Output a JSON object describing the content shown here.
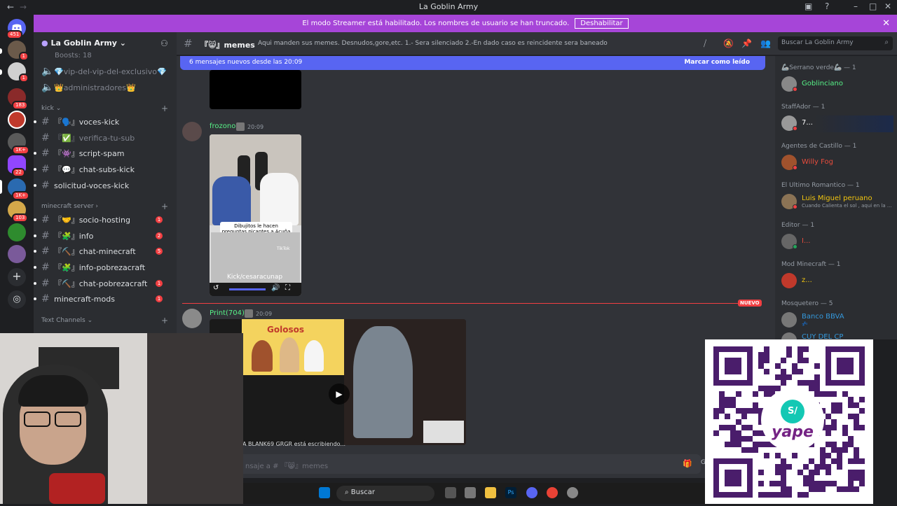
{
  "window": {
    "title": "La Goblin Army"
  },
  "banner": {
    "message": "El modo Streamer está habilitado. Los nombres de usuario se han truncado.",
    "button": "Deshabilitar",
    "color": "#a645d8"
  },
  "rail": {
    "badges": [
      "451",
      "1",
      "1",
      "183",
      "1K+",
      "22",
      "1K+",
      "103"
    ]
  },
  "sidebar": {
    "server_name": "La Goblin Army",
    "boosts": "Boosts: 18",
    "top_channels": [
      {
        "label": "💎vip-del-vip-del-exclusivo💎"
      },
      {
        "label": "👑administradores👑"
      }
    ],
    "categories": [
      {
        "name": "kick",
        "channels": [
          {
            "label": "『🗣️』voces-kick",
            "badge": ""
          },
          {
            "label": "『✅』verifica-tu-sub",
            "badge": ""
          },
          {
            "label": "『👾』script-spam",
            "badge": ""
          },
          {
            "label": "『💬』chat-subs-kick",
            "badge": ""
          },
          {
            "label": "solicitud-voces-kick",
            "badge": ""
          }
        ]
      },
      {
        "name": "minecraft server",
        "channels": [
          {
            "label": "『🤝』socio-hosting",
            "badge": "1"
          },
          {
            "label": "『🧩』info",
            "badge": "2"
          },
          {
            "label": "『⛏️』chat-minecraft",
            "badge": "5"
          },
          {
            "label": "『🧩』info-pobrezacraft",
            "badge": ""
          },
          {
            "label": "『⛏️』chat-pobrezacraft",
            "badge": "1"
          },
          {
            "label": "minecraft-mods",
            "badge": "1"
          }
        ]
      },
      {
        "name": "Text Channels",
        "channels": []
      }
    ]
  },
  "header": {
    "channel": "『😸』memes",
    "topic": "Aqui manden sus memes. Desnudos,gore,etc. 1.- Sera silenciado 2.-En dado caso es reincidente sera baneado",
    "search_placeholder": "Buscar La Goblin Army"
  },
  "chat": {
    "new_bar": {
      "text": "6 mensajes nuevos desde las 20:09",
      "action": "Marcar como leído"
    },
    "messages": [
      {
        "author": "frozono",
        "time": "20:09",
        "author_color": "#57f287",
        "caption": "Dibujitos le hacen preguntas picantes a Acuña 😳🥶",
        "video_label": "Kick/cesaracunap",
        "tiktok": "TikTok"
      },
      {
        "author": "Print(704)",
        "time": "20:09",
        "author_color": "#57f287",
        "video_title": "Golosos"
      }
    ],
    "new_label": "NUEVO",
    "typing": "A BLANK69 GRGR está escribiendo...",
    "composer_placeholder": "nsaje a # 『😸』memes"
  },
  "members": {
    "groups": [
      {
        "role": "🦾Serrano verde🦾 — 1",
        "members": [
          {
            "name": "Goblinciano",
            "color": "#57f287",
            "status": ""
          }
        ]
      },
      {
        "role": "StaffAdor — 1",
        "members": [
          {
            "name": "7...",
            "color": "#ffffff",
            "status": ""
          }
        ]
      },
      {
        "role": "Agentes de Castillo — 1",
        "members": [
          {
            "name": "Willy Fog",
            "color": "#e74c3c",
            "status": ""
          }
        ]
      },
      {
        "role": "El Ultimo Romantico — 1",
        "members": [
          {
            "name": "Luis Miguel peruano",
            "color": "#f1c40f",
            "status": "Cuando Calienta el sol , aqui en la ..."
          }
        ]
      },
      {
        "role": "Editor — 1",
        "members": [
          {
            "name": "I...",
            "color": "#e74c3c",
            "status": ""
          }
        ]
      },
      {
        "role": "Mod Minecraft — 1",
        "members": [
          {
            "name": "z...",
            "color": "#f1c40f",
            "status": ""
          }
        ]
      },
      {
        "role": "Mosquetero — 5",
        "members": [
          {
            "name": "Banco BBVA",
            "color": "#3498db",
            "status": "💤"
          },
          {
            "name": "CUY DEL CP",
            "color": "#3498db",
            "status": ""
          }
        ]
      }
    ]
  },
  "taskbar": {
    "search": "Buscar"
  },
  "qr": {
    "brand": "yape"
  }
}
